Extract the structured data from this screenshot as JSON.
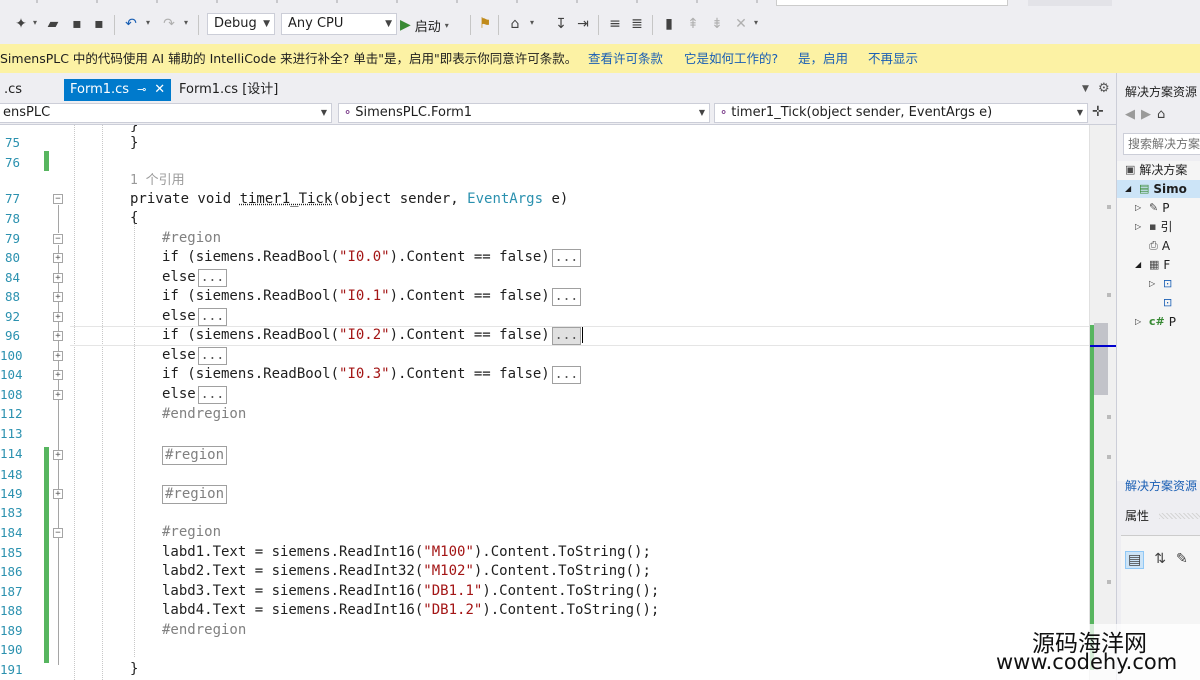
{
  "toolbar": {
    "config": "Debug",
    "platform": "Any CPU",
    "start_label": "启动"
  },
  "infobar": {
    "message": "SimensPLC 中的代码使用 AI 辅助的 IntelliCode 来进行补全? 单击\"是，启用\"即表示你同意许可条款。",
    "link_license": "查看许可条款",
    "link_how": "它是如何工作的?",
    "link_enable": "是，启用",
    "link_dismiss": "不再显示"
  },
  "tabs": [
    {
      "label": ".cs"
    },
    {
      "label": "Form1.cs",
      "active": true
    },
    {
      "label": "Form1.cs [设计]"
    }
  ],
  "navbar": {
    "project": "ensPLC",
    "class": "SimensPLC.Form1",
    "member": "timer1_Tick(object sender, EventArgs e)"
  },
  "editor": {
    "line_numbers": [
      "75",
      "76",
      "77",
      "78",
      "79",
      "80",
      "84",
      "88",
      "92",
      "96",
      "100",
      "104",
      "108",
      "112",
      "113",
      "114",
      "148",
      "149",
      "183",
      "184",
      "185",
      "186",
      "187",
      "188",
      "189",
      "190",
      "191"
    ],
    "reference_hint": "1 个引用",
    "lines": {
      "l75": "}",
      "l77_a": "private void ",
      "l77_b": "timer1_Tick",
      "l77_c": "(object sender, ",
      "l77_d": "EventArgs",
      "l77_e": " e)",
      "l78": "{",
      "l79": "#region",
      "l80_a": "if (siemens.ReadBool(",
      "l80_b": "\"I0.0\"",
      "l80_c": ").Content == false)",
      "l84": "else",
      "l88_a": "if (siemens.ReadBool(",
      "l88_b": "\"I0.1\"",
      "l88_c": ").Content == false)",
      "l92": "else",
      "l96_a": "if (siemens.ReadBool(",
      "l96_b": "\"I0.2\"",
      "l96_c": ").Content == false)",
      "l100": "else",
      "l104_a": "if (siemens.ReadBool(",
      "l104_b": "\"I0.3\"",
      "l104_c": ").Content == false)",
      "l108": "else",
      "l112": "#endregion",
      "l114": "#region",
      "l149": "#region",
      "l184": "#region",
      "l185_a": "labd1.Text = siemens.ReadInt16(",
      "l185_b": "\"M100\"",
      "l185_c": ").Content.ToString();",
      "l186_a": "labd2.Text = siemens.ReadInt32(",
      "l186_b": "\"M102\"",
      "l186_c": ").Content.ToString();",
      "l187_a": "labd3.Text = siemens.ReadInt16(",
      "l187_b": "\"DB1.1\"",
      "l187_c": ").Content.ToString();",
      "l188_a": "labd4.Text = siemens.ReadInt16(",
      "l188_b": "\"DB1.2\"",
      "l188_c": ").Content.ToString();",
      "l189": "#endregion",
      "l191": "}"
    },
    "collapsed_marker": "..."
  },
  "solution_explorer": {
    "title": "解决方案资源",
    "search_placeholder": "搜索解决方案",
    "items": [
      {
        "label": "解决方案"
      },
      {
        "label": "Simo"
      },
      {
        "label": "P"
      },
      {
        "label": "引"
      },
      {
        "label": "A"
      },
      {
        "label": "F"
      },
      {
        "label": ""
      },
      {
        "label": ""
      },
      {
        "label": "P"
      }
    ],
    "footer_link": "解决方案资源",
    "properties_title": "属性"
  },
  "watermark": {
    "cn": "源码海洋网",
    "url": "www.codehy.com"
  },
  "colors": {
    "accent": "#007acc",
    "infobar": "#fcf2a4",
    "line_number": "#2b91af",
    "string": "#a31515",
    "change_bar": "#57b55f"
  }
}
